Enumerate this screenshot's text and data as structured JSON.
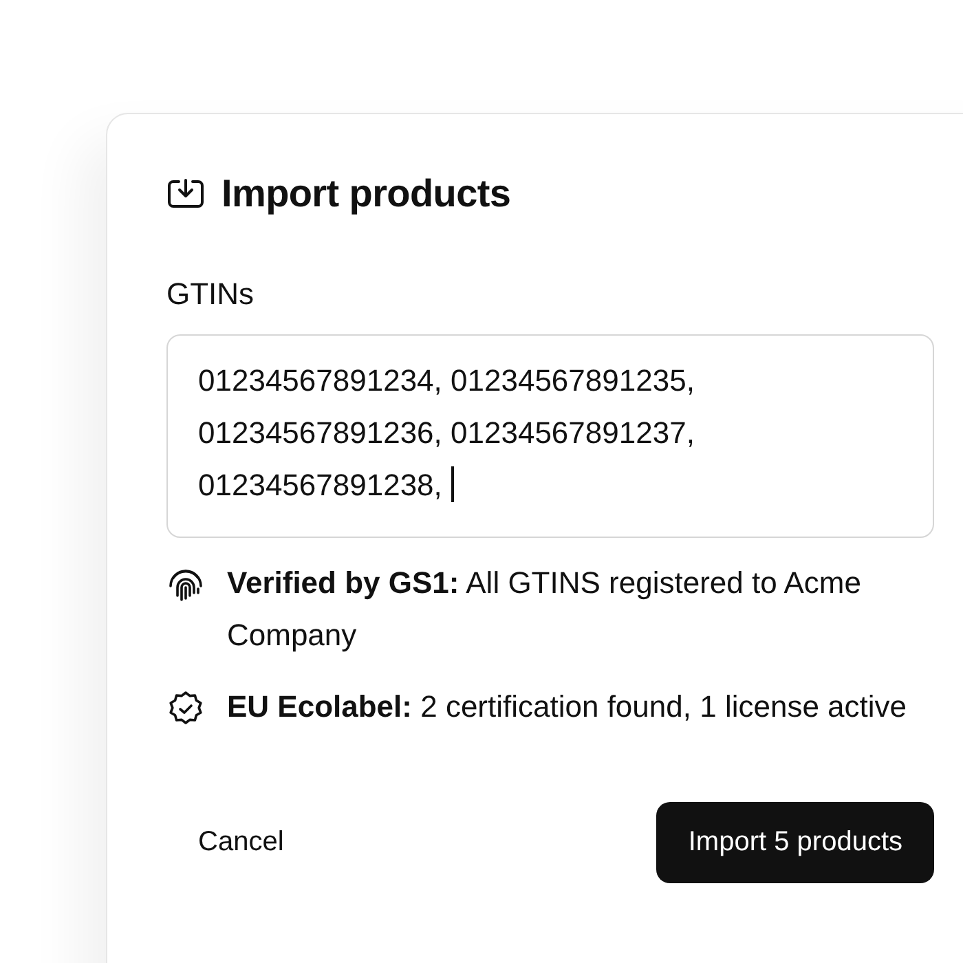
{
  "dialog": {
    "title": "Import products"
  },
  "field": {
    "label": "GTINs",
    "value": "01234567891234, 01234567891235, 01234567891236, 01234567891237, 01234567891238, ",
    "focused": true
  },
  "notes": [
    {
      "kind": "fingerprint",
      "text": "**Verified by GS1:** All GTINS registered to Acme Company"
    },
    {
      "kind": "seal",
      "text": "**EU Ecolabel:** 2 certification found, 1 license active"
    }
  ],
  "buttons": {
    "cancel": "Cancel",
    "confirm": "Import 5 products"
  }
}
